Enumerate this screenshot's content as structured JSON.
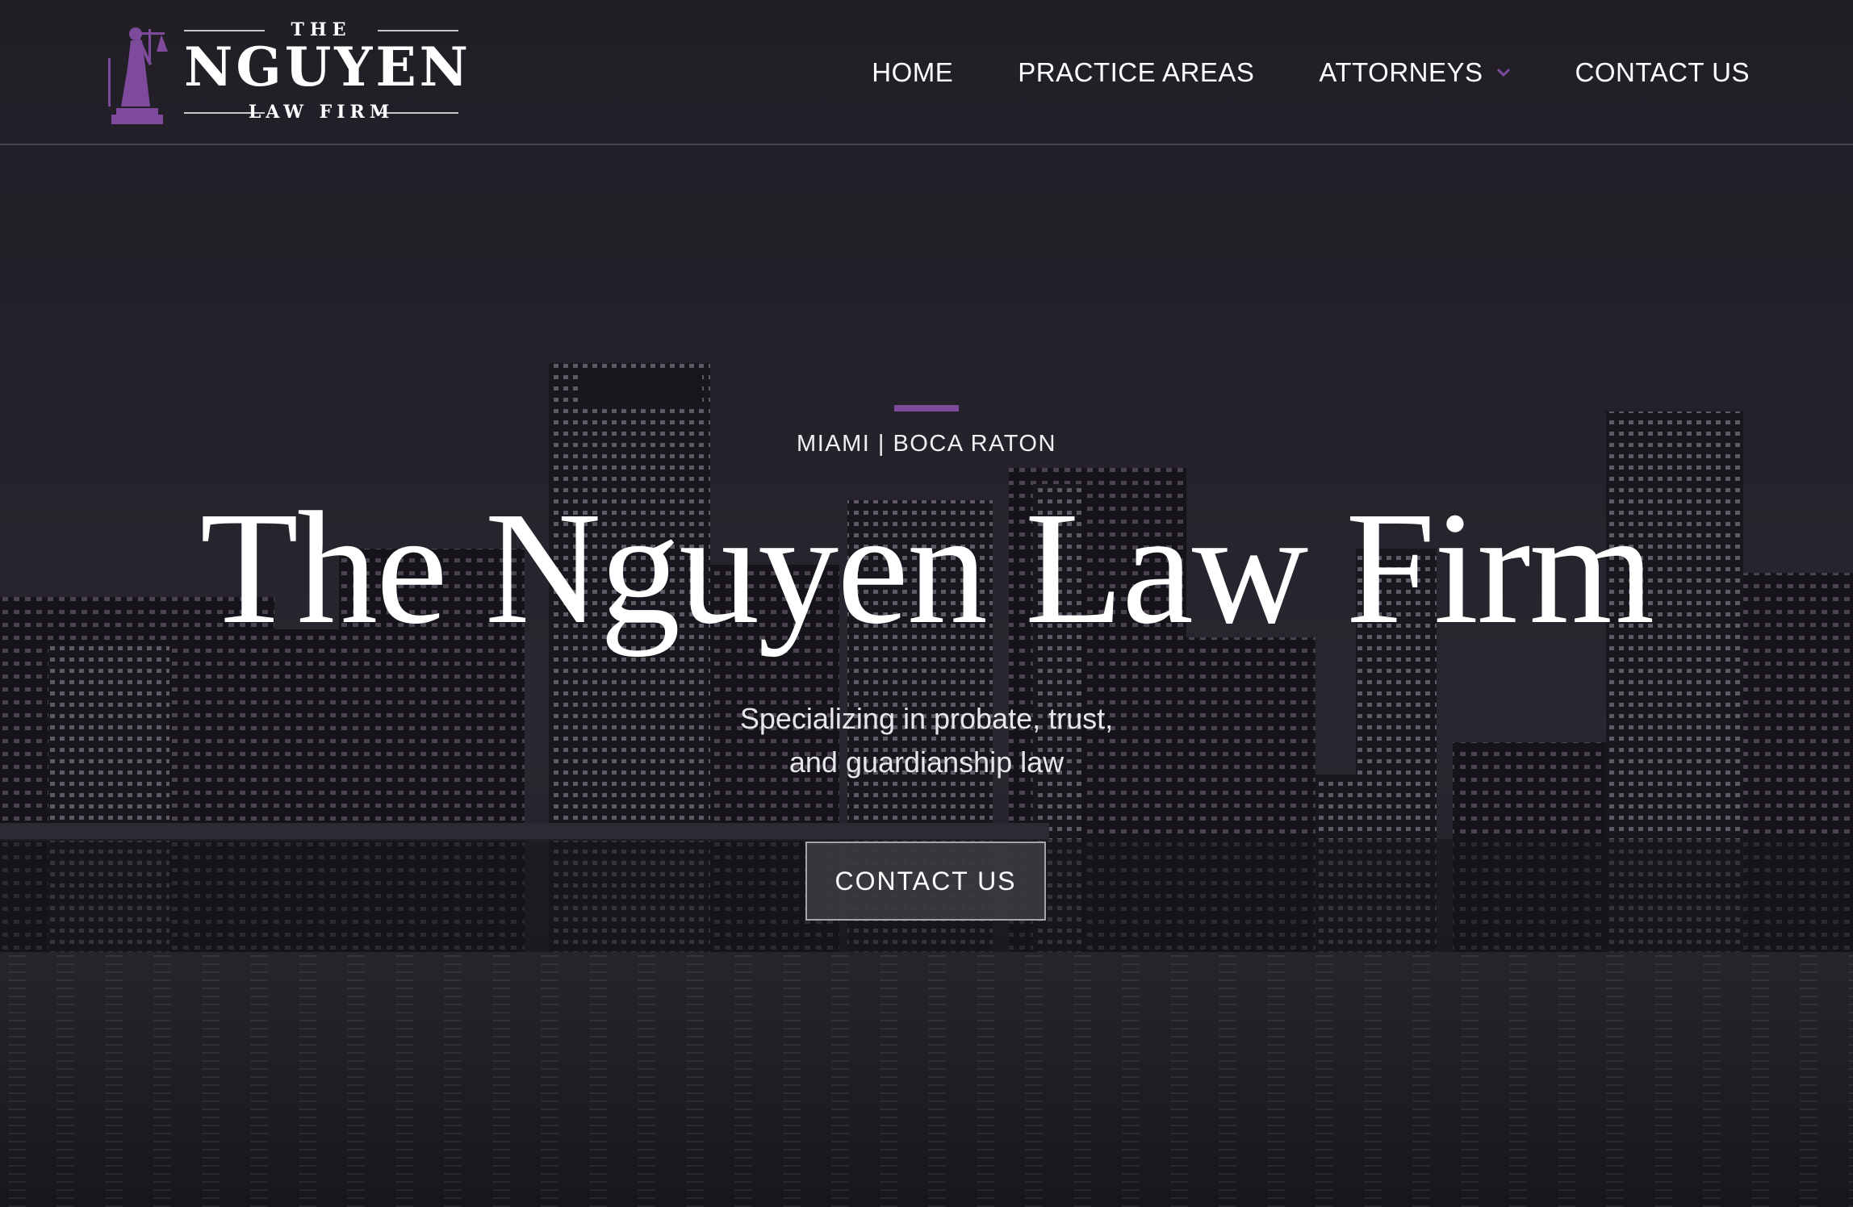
{
  "logo": {
    "top_word": "THE",
    "name": "NGUYEN",
    "sub": "LAW FIRM",
    "icon": "lady-justice-icon"
  },
  "nav": {
    "items": [
      {
        "label": "HOME"
      },
      {
        "label": "PRACTICE AREAS"
      },
      {
        "label": "ATTORNEYS",
        "icon": "chevron-down-icon"
      },
      {
        "label": "CONTACT US"
      }
    ]
  },
  "hero": {
    "locations": "MIAMI | BOCA RATON",
    "title": "The Nguyen Law Firm",
    "tagline_line1": "Specializing in probate, trust,",
    "tagline_line2": "and guardianship law",
    "cta_label": "CONTACT US",
    "background": "city-skyline-at-night"
  },
  "colors": {
    "accent": "#7e4a9c",
    "background": "#1d1b24",
    "text": "#ffffff"
  }
}
